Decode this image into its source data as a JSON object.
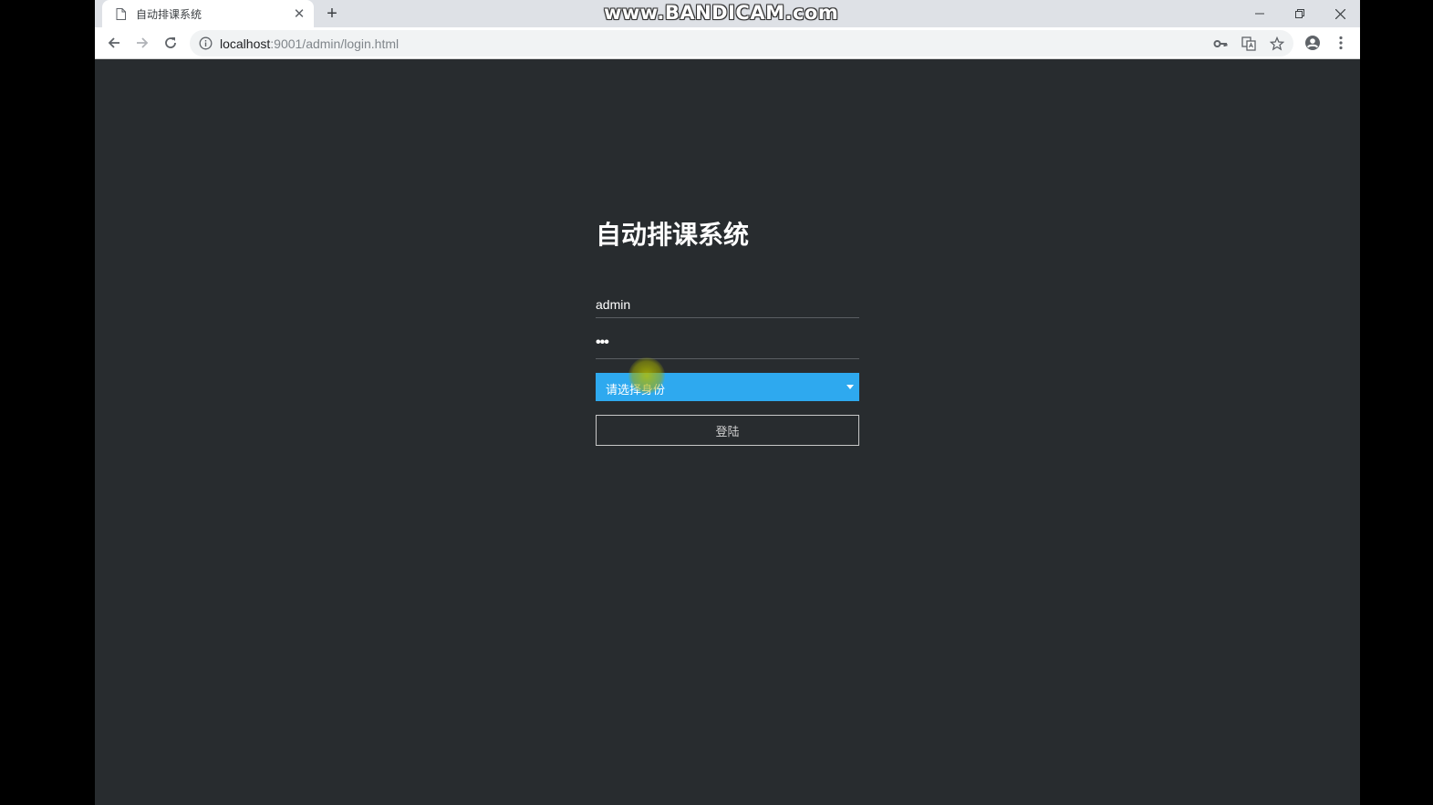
{
  "browser": {
    "tab_title": "自动排课系统",
    "tab_close_glyph": "✕",
    "new_tab_glyph": "+",
    "url_host": "localhost",
    "url_rest": ":9001/admin/login.html",
    "watermark": "www.BANDICAM.com"
  },
  "login": {
    "title": "自动排课系统",
    "username_value": "admin",
    "password_mask": "•••",
    "role_select_text": "请选择身份",
    "submit_label": "登陆"
  },
  "colors": {
    "page_background": "#282c2f",
    "select_background": "#2ea9ef",
    "outer_background": "#000000"
  },
  "icons": {
    "tab": "page-icon",
    "nav": [
      "back-arrow-icon",
      "forward-arrow-icon",
      "reload-icon"
    ],
    "omnibox": [
      "info-icon",
      "key-icon",
      "translate-icon",
      "star-icon"
    ],
    "toolbar_right": [
      "account-icon",
      "menu-dots-icon"
    ],
    "window": [
      "minimize-icon",
      "restore-icon",
      "close-icon"
    ]
  }
}
